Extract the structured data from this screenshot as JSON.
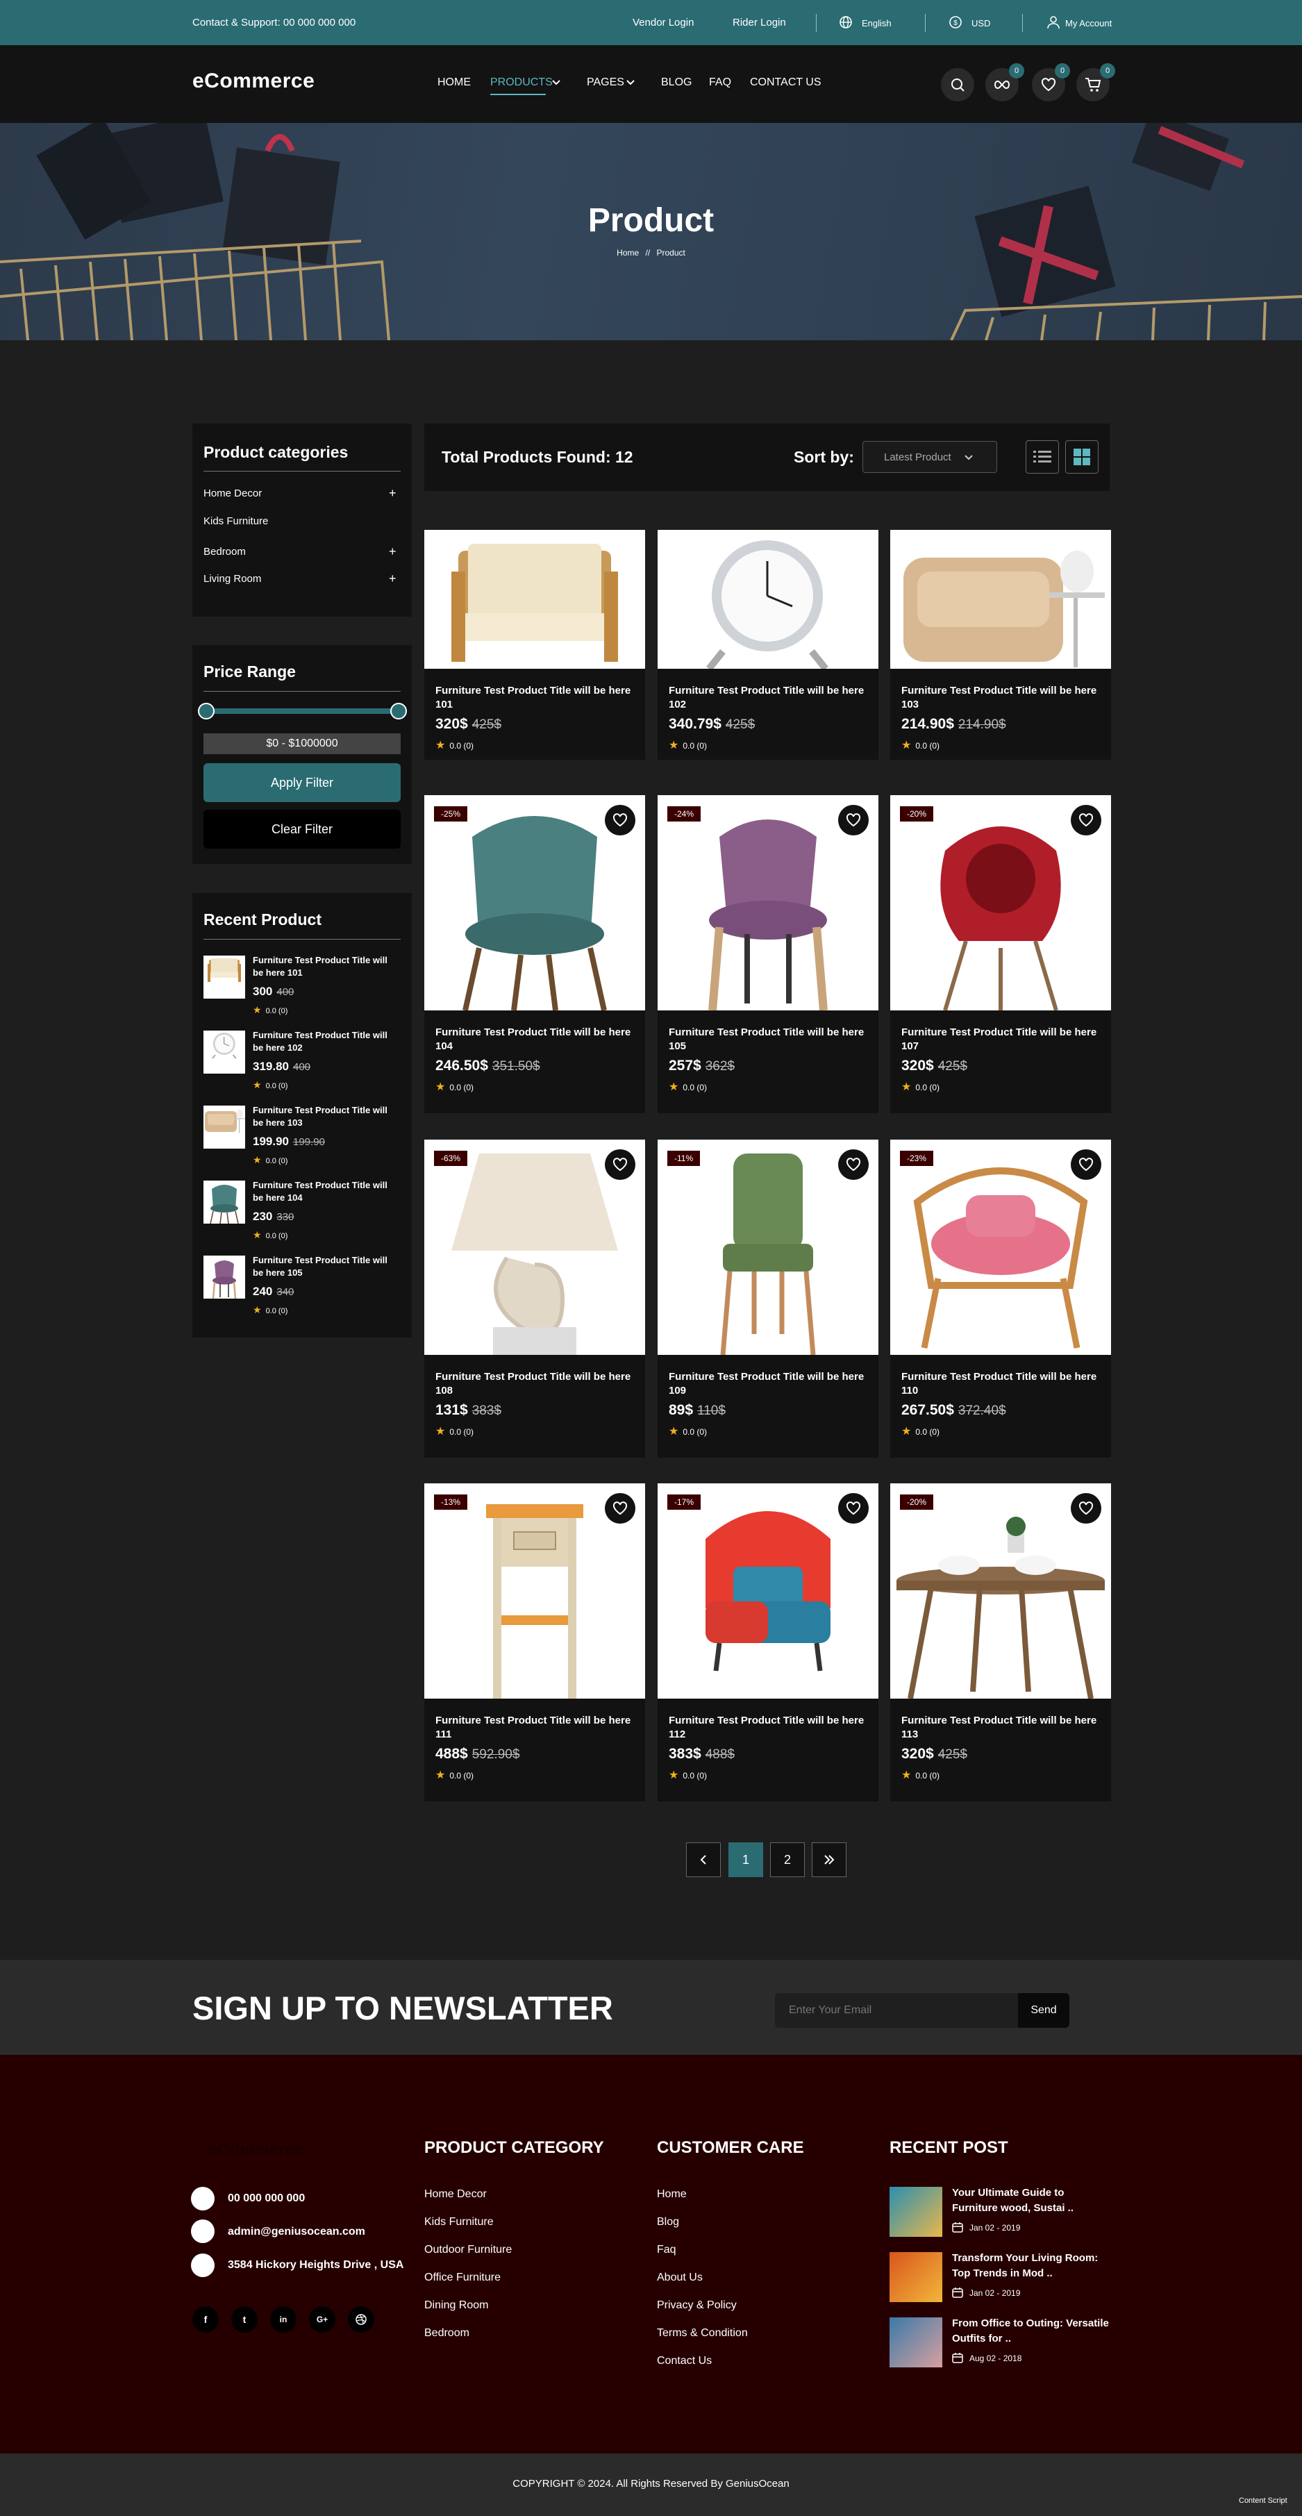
{
  "topbar": {
    "support": "Contact & Support: 00 000 000 000",
    "vendor_login": "Vendor Login",
    "rider_login": "Rider Login",
    "language": "English",
    "currency": "USD",
    "account": "My Account"
  },
  "header": {
    "logo": "eCommerce",
    "nav": [
      "HOME",
      "PRODUCTS",
      "PAGES",
      "BLOG",
      "FAQ",
      "CONTACT US"
    ],
    "badges": {
      "compare": "0",
      "wishlist": "0",
      "cart": "0"
    }
  },
  "hero": {
    "title": "Product",
    "breadcrumb_home": "Home",
    "breadcrumb_sep": "//",
    "breadcrumb_current": "Product"
  },
  "categories": {
    "title": "Product categories",
    "items": [
      "Home Decor",
      "Kids Furniture",
      "Bedroom",
      "Living Room"
    ]
  },
  "price": {
    "title": "Price Range",
    "range": "$0 - $1000000",
    "apply": "Apply Filter",
    "clear": "Clear Filter"
  },
  "recent": {
    "title": "Recent Product",
    "items": [
      {
        "title": "Furniture Test Product Title will be here 101",
        "price": "300",
        "old": "400",
        "rating": "0.0 (0)"
      },
      {
        "title": "Furniture Test Product Title will be here 102",
        "price": "319.80",
        "old": "400",
        "rating": "0.0 (0)"
      },
      {
        "title": "Furniture Test Product Title will be here 103",
        "price": "199.90",
        "old": "199.90",
        "rating": "0.0 (0)"
      },
      {
        "title": "Furniture Test Product Title will be here 104",
        "price": "230",
        "old": "330",
        "rating": "0.0 (0)"
      },
      {
        "title": "Furniture Test Product Title will be here 105",
        "price": "240",
        "old": "340",
        "rating": "0.0 (0)"
      }
    ]
  },
  "listing": {
    "found": "Total Products Found: 12",
    "sort_label": "Sort by:",
    "sort_value": "Latest Product"
  },
  "products": [
    {
      "title": "Furniture Test Product Title will be here 101",
      "price": "320$",
      "old": "425$",
      "rating": "0.0 (0)",
      "discount": ""
    },
    {
      "title": "Furniture Test Product Title will be here 102",
      "price": "340.79$",
      "old": "425$",
      "rating": "0.0 (0)",
      "discount": ""
    },
    {
      "title": "Furniture Test Product Title will be here 103",
      "price": "214.90$",
      "old": "214.90$",
      "rating": "0.0 (0)",
      "discount": ""
    },
    {
      "title": "Furniture Test Product Title will be here 104",
      "price": "246.50$",
      "old": "351.50$",
      "rating": "0.0 (0)",
      "discount": "-25%"
    },
    {
      "title": "Furniture Test Product Title will be here 105",
      "price": "257$",
      "old": "362$",
      "rating": "0.0 (0)",
      "discount": "-24%"
    },
    {
      "title": "Furniture Test Product Title will be here 107",
      "price": "320$",
      "old": "425$",
      "rating": "0.0 (0)",
      "discount": "-20%"
    },
    {
      "title": "Furniture Test Product Title will be here 108",
      "price": "131$",
      "old": "383$",
      "rating": "0.0 (0)",
      "discount": "-63%"
    },
    {
      "title": "Furniture Test Product Title will be here 109",
      "price": "89$",
      "old": "110$",
      "rating": "0.0 (0)",
      "discount": "-11%"
    },
    {
      "title": "Furniture Test Product Title will be here 110",
      "price": "267.50$",
      "old": "372.40$",
      "rating": "0.0 (0)",
      "discount": "-23%"
    },
    {
      "title": "Furniture Test Product Title will be here 111",
      "price": "488$",
      "old": "592.90$",
      "rating": "0.0 (0)",
      "discount": "-13%"
    },
    {
      "title": "Furniture Test Product Title will be here 112",
      "price": "383$",
      "old": "488$",
      "rating": "0.0 (0)",
      "discount": "-17%"
    },
    {
      "title": "Furniture Test Product Title will be here 113",
      "price": "320$",
      "old": "425$",
      "rating": "0.0 (0)",
      "discount": "-20%"
    }
  ],
  "pagination": {
    "pages": [
      "1",
      "2"
    ],
    "current": "1"
  },
  "newsletter": {
    "title": "SIGN UP TO NEWSLATTER",
    "placeholder": "Enter Your Email",
    "button": "Send"
  },
  "footer": {
    "logo": "eCommerce",
    "phone": "00 000 000 000",
    "email": "admin@geniusocean.com",
    "address": "3584 Hickory Heights Drive , USA",
    "social": [
      "f",
      "t",
      "in",
      "G+",
      "dribbble"
    ],
    "category_title": "PRODUCT CATEGORY",
    "categories": [
      "Home Decor",
      "Kids Furniture",
      "Outdoor Furniture",
      "Office Furniture",
      "Dining Room",
      "Bedroom"
    ],
    "care_title": "CUSTOMER CARE",
    "care": [
      "Home",
      "Blog",
      "Faq",
      "About Us",
      "Privacy & Policy",
      "Terms & Condition",
      "Contact Us"
    ],
    "post_title": "RECENT POST",
    "posts": [
      {
        "title": "Your Ultimate Guide to Furniture wood, Sustai ..",
        "date": "Jan 02 - 2019"
      },
      {
        "title": "Transform Your Living Room: Top Trends in Mod ..",
        "date": "Jan 02 - 2019"
      },
      {
        "title": "From Office to Outing: Versatile Outfits for ..",
        "date": "Aug 02 - 2018"
      }
    ]
  },
  "copyright": "COPYRIGHT © 2024. All Rights Reserved By GeniusOcean",
  "content_script": "Content Script",
  "colors": {
    "accent": "#2b6c73",
    "accent_light": "#5fb7bf",
    "footer_bg": "#260000",
    "star": "#f2b01e"
  }
}
